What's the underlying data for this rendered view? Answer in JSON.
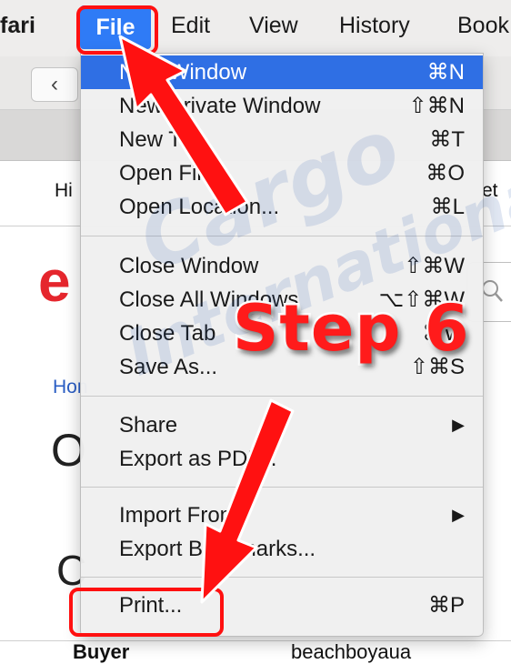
{
  "menubar": {
    "items": [
      "fari",
      "File",
      "Edit",
      "View",
      "History",
      "Book"
    ]
  },
  "background": {
    "back_glyph": "‹",
    "hi_text": "Hi",
    "et_text": "et",
    "logo_letter": "e",
    "hom_text": "Hon",
    "big_o": "O",
    "big_c": "C",
    "buyer_label": "Buyer",
    "buyer_value": "beachboyaua"
  },
  "menu": {
    "items": [
      {
        "label": "New Window",
        "shortcut": "⌘N"
      },
      {
        "label": "New Private Window",
        "shortcut": "⇧⌘N"
      },
      {
        "label": "New Tab",
        "shortcut": "⌘T"
      },
      {
        "label": "Open File...",
        "shortcut": "⌘O"
      },
      {
        "label": "Open Location...",
        "shortcut": "⌘L"
      },
      {
        "label": "Close Window",
        "shortcut": "⇧⌘W"
      },
      {
        "label": "Close All Windows",
        "shortcut": "⌥⇧⌘W"
      },
      {
        "label": "Close Tab",
        "shortcut": "⌘W"
      },
      {
        "label": "Save As...",
        "shortcut": "⇧⌘S"
      },
      {
        "label": "Share",
        "shortcut": "▶"
      },
      {
        "label": "Export as PDF...",
        "shortcut": ""
      },
      {
        "label": "Import From",
        "shortcut": "▶"
      },
      {
        "label": "Export Bookmarks...",
        "shortcut": ""
      },
      {
        "label": "Print...",
        "shortcut": "⌘P"
      }
    ]
  },
  "annotation": {
    "step_text": "Step 6",
    "color": "#ff1b1b",
    "watermark_text": "Cargo International"
  },
  "colors": {
    "menu_highlight": "#2f6fe4",
    "file_highlight": "#2f7bf6"
  }
}
